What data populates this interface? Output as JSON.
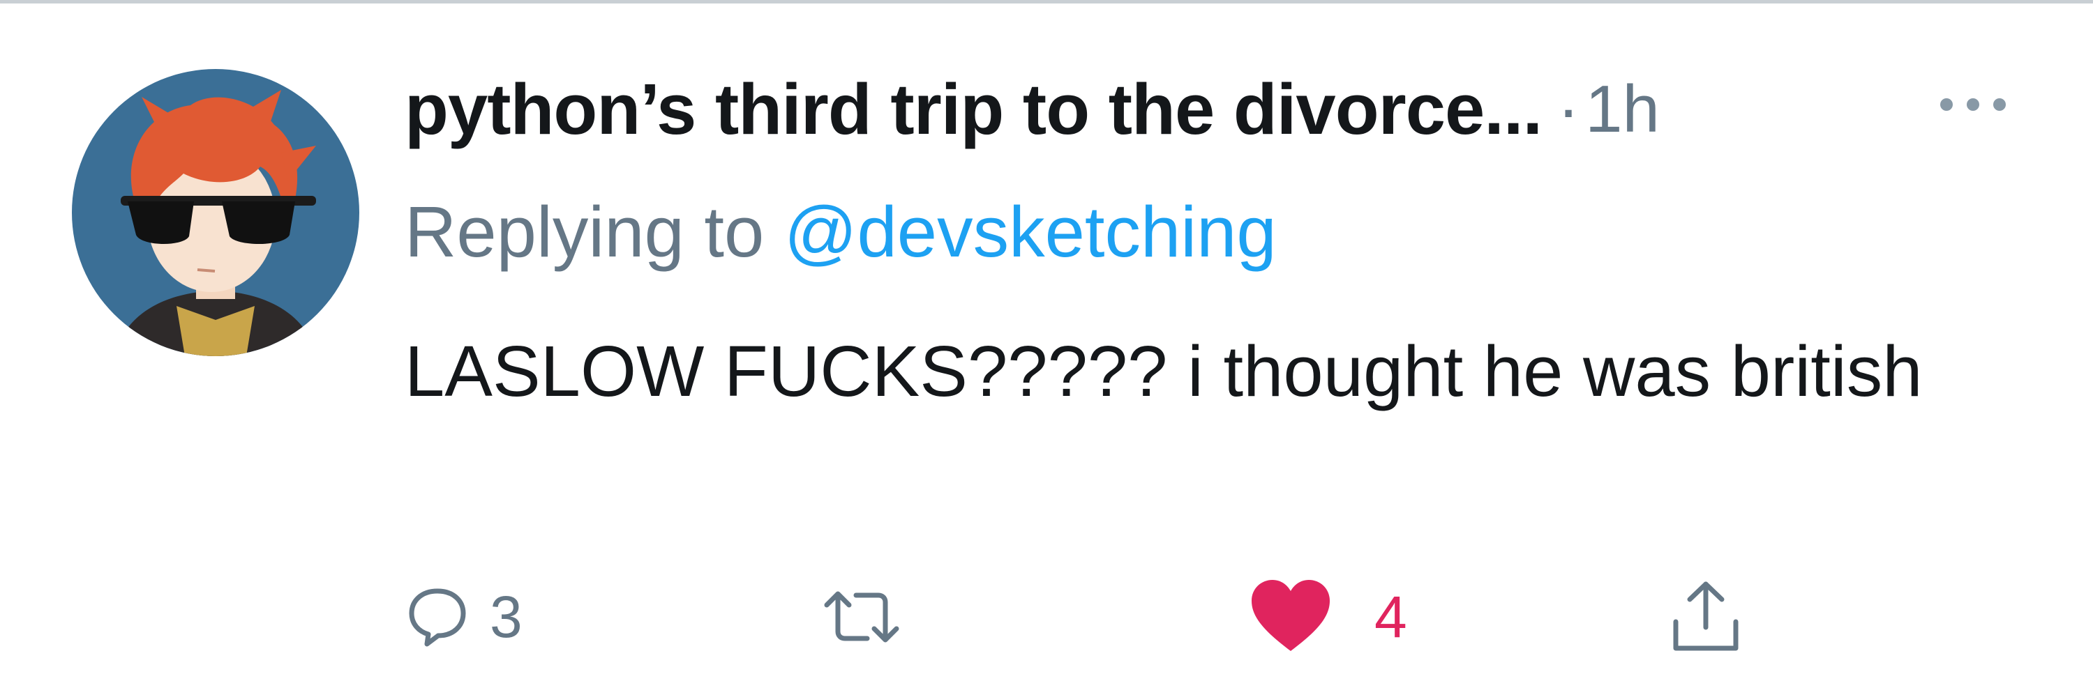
{
  "tweet": {
    "display_name": "python’s third trip to the divorce...",
    "separator": "·",
    "time": "1h",
    "replying_prefix": "Replying to",
    "replying_handle": "@devsketching",
    "text": "LASLOW FUCKS????? i thought he was british"
  },
  "actions": {
    "reply_count": "3",
    "like_count": "4",
    "like_active": true
  },
  "colors": {
    "text_primary": "#14171a",
    "text_secondary": "#657786",
    "link": "#1da1f2",
    "like": "#e0245e",
    "avatar_background": "#3b6f96",
    "avatar_hair": "#e05a33"
  },
  "icons": {
    "more": "more-icon",
    "reply": "reply-icon",
    "retweet": "retweet-icon",
    "like": "heart-icon",
    "share": "share-icon"
  }
}
